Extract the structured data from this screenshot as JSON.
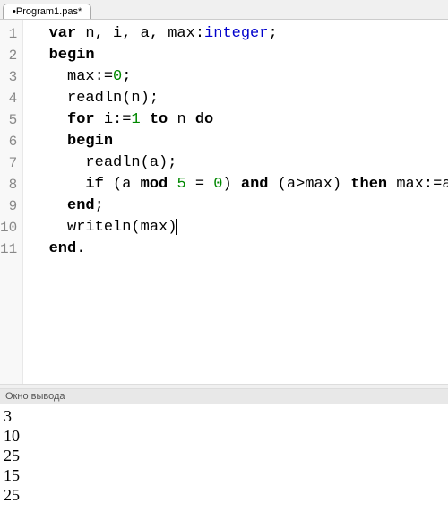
{
  "tab": {
    "label": "•Program1.pas*"
  },
  "code": {
    "lines": [
      {
        "num": 1,
        "tokens": [
          {
            "t": "  "
          },
          {
            "t": "var",
            "c": "kw"
          },
          {
            "t": " n, i, a, max:"
          },
          {
            "t": "integer",
            "c": "type"
          },
          {
            "t": ";"
          }
        ]
      },
      {
        "num": 2,
        "tokens": [
          {
            "t": "  "
          },
          {
            "t": "begin",
            "c": "kw"
          }
        ]
      },
      {
        "num": 3,
        "tokens": [
          {
            "t": "    max:="
          },
          {
            "t": "0",
            "c": "num"
          },
          {
            "t": ";"
          }
        ]
      },
      {
        "num": 4,
        "tokens": [
          {
            "t": "    readln(n);"
          }
        ]
      },
      {
        "num": 5,
        "tokens": [
          {
            "t": "    "
          },
          {
            "t": "for",
            "c": "kw"
          },
          {
            "t": " i:="
          },
          {
            "t": "1",
            "c": "num"
          },
          {
            "t": " "
          },
          {
            "t": "to",
            "c": "kw"
          },
          {
            "t": " n "
          },
          {
            "t": "do",
            "c": "kw"
          }
        ]
      },
      {
        "num": 6,
        "tokens": [
          {
            "t": "    "
          },
          {
            "t": "begin",
            "c": "kw"
          }
        ]
      },
      {
        "num": 7,
        "tokens": [
          {
            "t": "      readln(a);"
          }
        ]
      },
      {
        "num": 8,
        "tokens": [
          {
            "t": "      "
          },
          {
            "t": "if",
            "c": "kw"
          },
          {
            "t": " (a "
          },
          {
            "t": "mod",
            "c": "kw"
          },
          {
            "t": " "
          },
          {
            "t": "5",
            "c": "num"
          },
          {
            "t": " = "
          },
          {
            "t": "0",
            "c": "num"
          },
          {
            "t": ") "
          },
          {
            "t": "and",
            "c": "kw"
          },
          {
            "t": " (a>max) "
          },
          {
            "t": "then",
            "c": "kw"
          },
          {
            "t": " max:=a;"
          }
        ]
      },
      {
        "num": 9,
        "tokens": [
          {
            "t": "    "
          },
          {
            "t": "end",
            "c": "kw"
          },
          {
            "t": ";"
          }
        ]
      },
      {
        "num": 10,
        "tokens": [
          {
            "t": "    writeln(max)"
          }
        ],
        "cursor": true
      },
      {
        "num": 11,
        "tokens": [
          {
            "t": "  "
          },
          {
            "t": "end",
            "c": "kw"
          },
          {
            "t": "."
          }
        ]
      }
    ]
  },
  "output": {
    "header": "Окно вывода",
    "lines": [
      "3",
      "10",
      "25",
      "15",
      "25"
    ]
  }
}
